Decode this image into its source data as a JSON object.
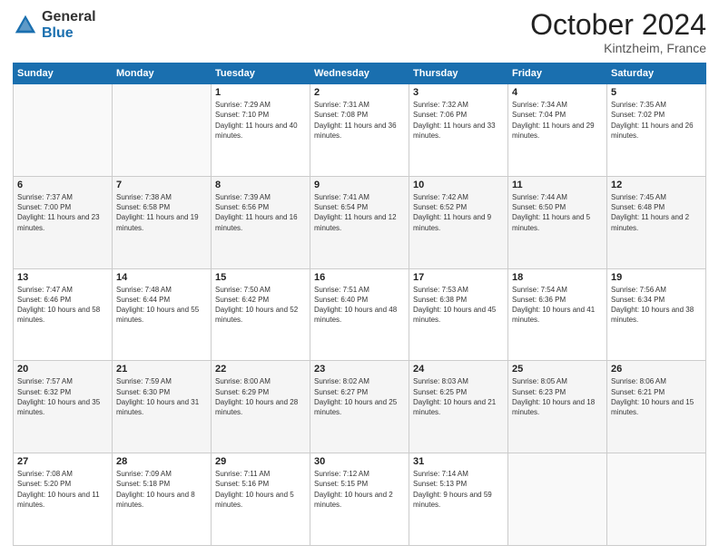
{
  "header": {
    "logo_general": "General",
    "logo_blue": "Blue",
    "month_title": "October 2024",
    "subtitle": "Kintzheim, France"
  },
  "days_of_week": [
    "Sunday",
    "Monday",
    "Tuesday",
    "Wednesday",
    "Thursday",
    "Friday",
    "Saturday"
  ],
  "weeks": [
    [
      {
        "day": "",
        "sunrise": "",
        "sunset": "",
        "daylight": ""
      },
      {
        "day": "",
        "sunrise": "",
        "sunset": "",
        "daylight": ""
      },
      {
        "day": "1",
        "sunrise": "Sunrise: 7:29 AM",
        "sunset": "Sunset: 7:10 PM",
        "daylight": "Daylight: 11 hours and 40 minutes."
      },
      {
        "day": "2",
        "sunrise": "Sunrise: 7:31 AM",
        "sunset": "Sunset: 7:08 PM",
        "daylight": "Daylight: 11 hours and 36 minutes."
      },
      {
        "day": "3",
        "sunrise": "Sunrise: 7:32 AM",
        "sunset": "Sunset: 7:06 PM",
        "daylight": "Daylight: 11 hours and 33 minutes."
      },
      {
        "day": "4",
        "sunrise": "Sunrise: 7:34 AM",
        "sunset": "Sunset: 7:04 PM",
        "daylight": "Daylight: 11 hours and 29 minutes."
      },
      {
        "day": "5",
        "sunrise": "Sunrise: 7:35 AM",
        "sunset": "Sunset: 7:02 PM",
        "daylight": "Daylight: 11 hours and 26 minutes."
      }
    ],
    [
      {
        "day": "6",
        "sunrise": "Sunrise: 7:37 AM",
        "sunset": "Sunset: 7:00 PM",
        "daylight": "Daylight: 11 hours and 23 minutes."
      },
      {
        "day": "7",
        "sunrise": "Sunrise: 7:38 AM",
        "sunset": "Sunset: 6:58 PM",
        "daylight": "Daylight: 11 hours and 19 minutes."
      },
      {
        "day": "8",
        "sunrise": "Sunrise: 7:39 AM",
        "sunset": "Sunset: 6:56 PM",
        "daylight": "Daylight: 11 hours and 16 minutes."
      },
      {
        "day": "9",
        "sunrise": "Sunrise: 7:41 AM",
        "sunset": "Sunset: 6:54 PM",
        "daylight": "Daylight: 11 hours and 12 minutes."
      },
      {
        "day": "10",
        "sunrise": "Sunrise: 7:42 AM",
        "sunset": "Sunset: 6:52 PM",
        "daylight": "Daylight: 11 hours and 9 minutes."
      },
      {
        "day": "11",
        "sunrise": "Sunrise: 7:44 AM",
        "sunset": "Sunset: 6:50 PM",
        "daylight": "Daylight: 11 hours and 5 minutes."
      },
      {
        "day": "12",
        "sunrise": "Sunrise: 7:45 AM",
        "sunset": "Sunset: 6:48 PM",
        "daylight": "Daylight: 11 hours and 2 minutes."
      }
    ],
    [
      {
        "day": "13",
        "sunrise": "Sunrise: 7:47 AM",
        "sunset": "Sunset: 6:46 PM",
        "daylight": "Daylight: 10 hours and 58 minutes."
      },
      {
        "day": "14",
        "sunrise": "Sunrise: 7:48 AM",
        "sunset": "Sunset: 6:44 PM",
        "daylight": "Daylight: 10 hours and 55 minutes."
      },
      {
        "day": "15",
        "sunrise": "Sunrise: 7:50 AM",
        "sunset": "Sunset: 6:42 PM",
        "daylight": "Daylight: 10 hours and 52 minutes."
      },
      {
        "day": "16",
        "sunrise": "Sunrise: 7:51 AM",
        "sunset": "Sunset: 6:40 PM",
        "daylight": "Daylight: 10 hours and 48 minutes."
      },
      {
        "day": "17",
        "sunrise": "Sunrise: 7:53 AM",
        "sunset": "Sunset: 6:38 PM",
        "daylight": "Daylight: 10 hours and 45 minutes."
      },
      {
        "day": "18",
        "sunrise": "Sunrise: 7:54 AM",
        "sunset": "Sunset: 6:36 PM",
        "daylight": "Daylight: 10 hours and 41 minutes."
      },
      {
        "day": "19",
        "sunrise": "Sunrise: 7:56 AM",
        "sunset": "Sunset: 6:34 PM",
        "daylight": "Daylight: 10 hours and 38 minutes."
      }
    ],
    [
      {
        "day": "20",
        "sunrise": "Sunrise: 7:57 AM",
        "sunset": "Sunset: 6:32 PM",
        "daylight": "Daylight: 10 hours and 35 minutes."
      },
      {
        "day": "21",
        "sunrise": "Sunrise: 7:59 AM",
        "sunset": "Sunset: 6:30 PM",
        "daylight": "Daylight: 10 hours and 31 minutes."
      },
      {
        "day": "22",
        "sunrise": "Sunrise: 8:00 AM",
        "sunset": "Sunset: 6:29 PM",
        "daylight": "Daylight: 10 hours and 28 minutes."
      },
      {
        "day": "23",
        "sunrise": "Sunrise: 8:02 AM",
        "sunset": "Sunset: 6:27 PM",
        "daylight": "Daylight: 10 hours and 25 minutes."
      },
      {
        "day": "24",
        "sunrise": "Sunrise: 8:03 AM",
        "sunset": "Sunset: 6:25 PM",
        "daylight": "Daylight: 10 hours and 21 minutes."
      },
      {
        "day": "25",
        "sunrise": "Sunrise: 8:05 AM",
        "sunset": "Sunset: 6:23 PM",
        "daylight": "Daylight: 10 hours and 18 minutes."
      },
      {
        "day": "26",
        "sunrise": "Sunrise: 8:06 AM",
        "sunset": "Sunset: 6:21 PM",
        "daylight": "Daylight: 10 hours and 15 minutes."
      }
    ],
    [
      {
        "day": "27",
        "sunrise": "Sunrise: 7:08 AM",
        "sunset": "Sunset: 5:20 PM",
        "daylight": "Daylight: 10 hours and 11 minutes."
      },
      {
        "day": "28",
        "sunrise": "Sunrise: 7:09 AM",
        "sunset": "Sunset: 5:18 PM",
        "daylight": "Daylight: 10 hours and 8 minutes."
      },
      {
        "day": "29",
        "sunrise": "Sunrise: 7:11 AM",
        "sunset": "Sunset: 5:16 PM",
        "daylight": "Daylight: 10 hours and 5 minutes."
      },
      {
        "day": "30",
        "sunrise": "Sunrise: 7:12 AM",
        "sunset": "Sunset: 5:15 PM",
        "daylight": "Daylight: 10 hours and 2 minutes."
      },
      {
        "day": "31",
        "sunrise": "Sunrise: 7:14 AM",
        "sunset": "Sunset: 5:13 PM",
        "daylight": "Daylight: 9 hours and 59 minutes."
      },
      {
        "day": "",
        "sunrise": "",
        "sunset": "",
        "daylight": ""
      },
      {
        "day": "",
        "sunrise": "",
        "sunset": "",
        "daylight": ""
      }
    ]
  ]
}
